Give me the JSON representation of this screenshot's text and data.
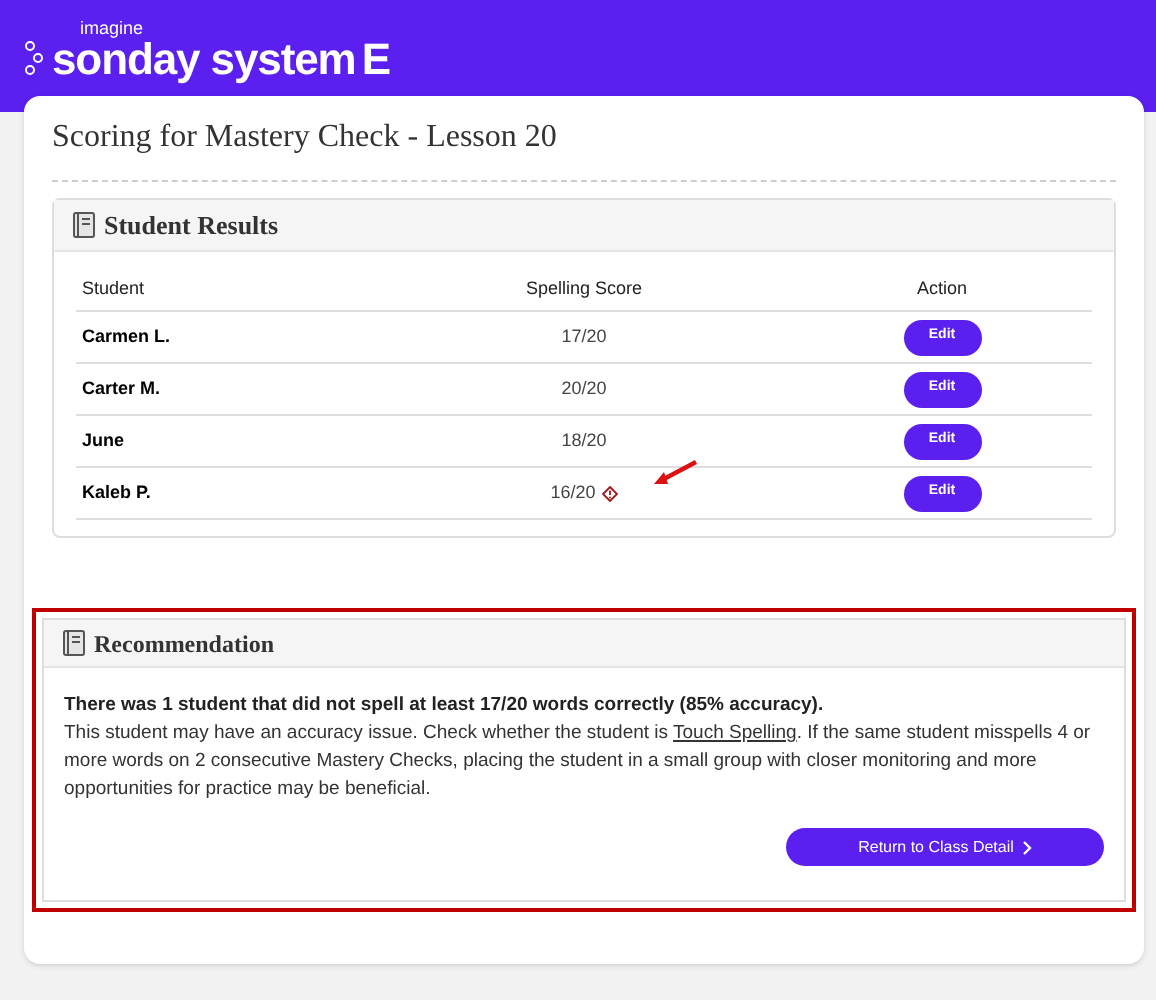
{
  "brand": {
    "tagline": "imagine",
    "name": "sonday system",
    "suffix": "E"
  },
  "page": {
    "title": "Scoring for Mastery Check - Lesson 20"
  },
  "results": {
    "title": "Student Results",
    "columns": [
      "Student",
      "Spelling Score",
      "Action"
    ],
    "rows": [
      {
        "student": "Carmen L.",
        "score": "17/20",
        "action": "Edit",
        "warning": false,
        "annotated": false
      },
      {
        "student": "Carter M.",
        "score": "20/20",
        "action": "Edit",
        "warning": false,
        "annotated": false
      },
      {
        "student": "June",
        "score": "18/20",
        "action": "Edit",
        "warning": false,
        "annotated": false
      },
      {
        "student": "Kaleb P.",
        "score": "16/20",
        "action": "Edit",
        "warning": true,
        "annotated": true
      }
    ]
  },
  "recommendation": {
    "title": "Recommendation",
    "highlighted": true,
    "summary": "There was 1 student that did not spell at least 17/20 words correctly (85% accuracy).",
    "text_before": "This student may have an accuracy issue. Check whether the student is",
    "link": "Touch Spelling",
    "text_after": ". If the same student misspells 4 or more words on 2 consecutive Mastery Checks, placing the student in a small group with closer monitoring and more opportunities for practice may be beneficial.",
    "button": "Return to Class Detail"
  }
}
